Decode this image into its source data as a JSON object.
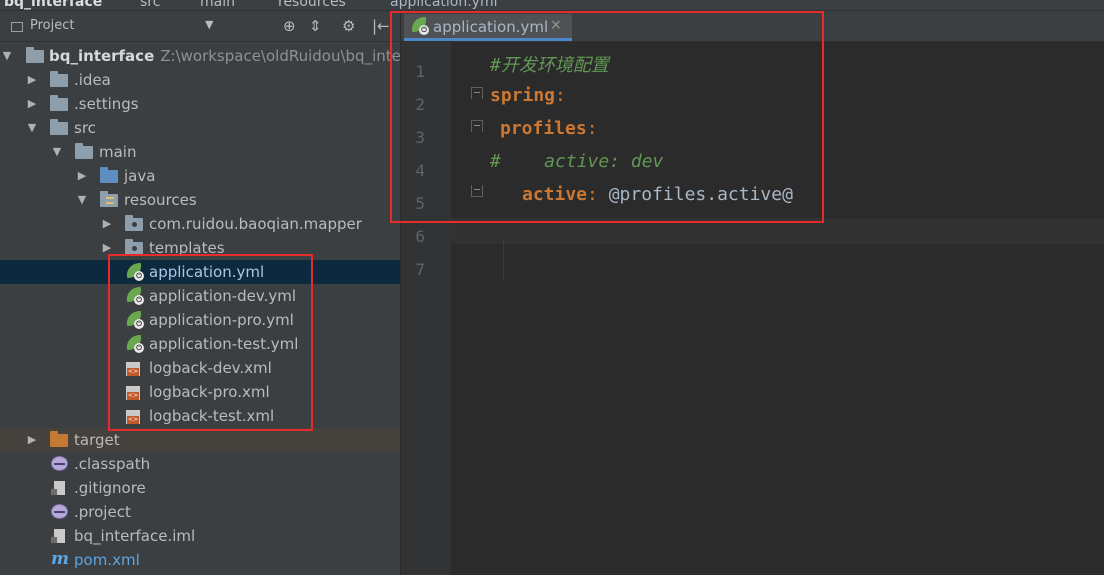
{
  "breadcrumbs": [
    {
      "label": "bq_interface",
      "icon": "module-folder-icon"
    },
    {
      "label": "src",
      "icon": "folder-icon"
    },
    {
      "label": "main",
      "icon": "folder-icon"
    },
    {
      "label": "resources",
      "icon": "resources-folder-icon"
    },
    {
      "label": "application.yml",
      "icon": "spring-yml-icon"
    }
  ],
  "project_panel": {
    "title": "Project",
    "dropdown": "▼",
    "toolbar": [
      "⊕",
      "⇕",
      "⚙",
      "|←"
    ]
  },
  "tree": {
    "root": {
      "label": "bq_interface",
      "path": "Z:\\workspace\\oldRuidou\\bq_interf"
    },
    "items": [
      {
        "label": ".idea"
      },
      {
        "label": ".settings"
      },
      {
        "label": "src"
      },
      {
        "label": "main"
      },
      {
        "label": "java"
      },
      {
        "label": "resources"
      },
      {
        "label": "com.ruidou.baoqian.mapper"
      },
      {
        "label": "templates"
      },
      {
        "label": "application.yml"
      },
      {
        "label": "application-dev.yml"
      },
      {
        "label": "application-pro.yml"
      },
      {
        "label": "application-test.yml"
      },
      {
        "label": "logback-dev.xml"
      },
      {
        "label": "logback-pro.xml"
      },
      {
        "label": "logback-test.xml"
      },
      {
        "label": "target"
      },
      {
        "label": ".classpath"
      },
      {
        "label": ".gitignore"
      },
      {
        "label": ".project"
      },
      {
        "label": "bq_interface.iml"
      },
      {
        "label": "pom.xml"
      }
    ]
  },
  "editor": {
    "tab": {
      "label": "application.yml",
      "close": "×"
    },
    "line_numbers": [
      "1",
      "2",
      "3",
      "4",
      "5",
      "6",
      "7"
    ],
    "lines": {
      "l1_comment": "#开发环境配置",
      "l2_key": "spring",
      "l3_key": "profiles",
      "l4_comment": "#    active: dev",
      "l5_key": "active",
      "l5_value": "@profiles.active@",
      "colon": ":"
    }
  },
  "colors": {
    "highlight_border": "#e52b2b",
    "selection": "#0d293e",
    "yaml_key": "#cc7832",
    "comment": "#629755"
  }
}
